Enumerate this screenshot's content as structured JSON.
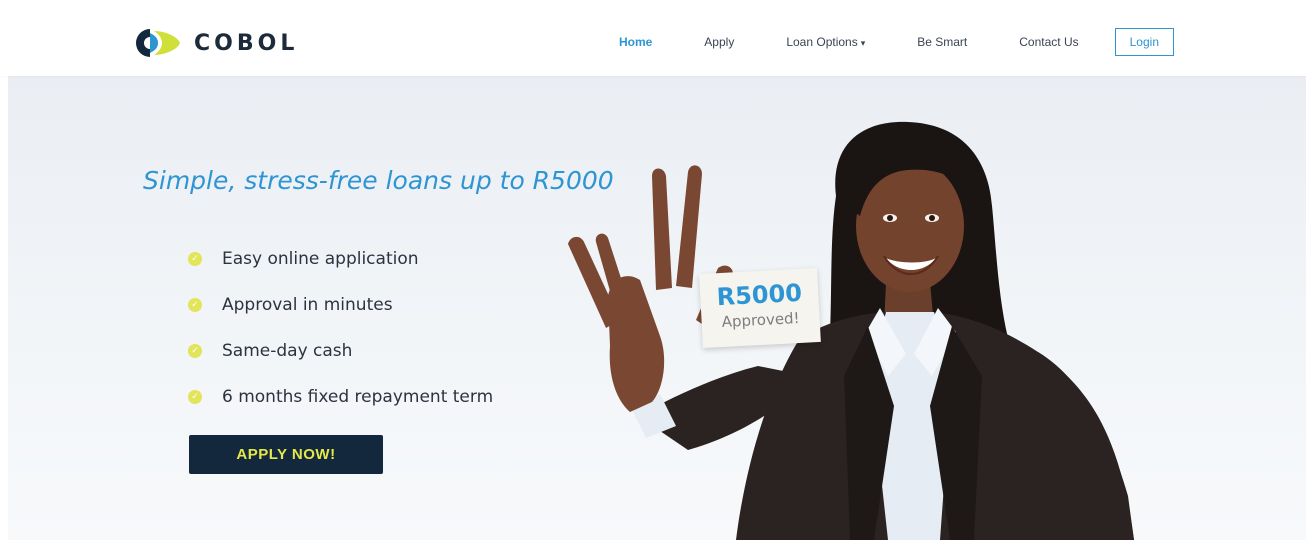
{
  "brand": {
    "name": "COBOL",
    "logo_icon": "cobol-logo-icon",
    "colors": {
      "dark": "#13283d",
      "accent": "#2e95d3",
      "highlight": "#e5e84a"
    }
  },
  "nav": {
    "items": [
      {
        "label": "Home",
        "active": true
      },
      {
        "label": "Apply",
        "active": false
      },
      {
        "label": "Loan Options",
        "active": false,
        "dropdown": true
      },
      {
        "label": "Be Smart",
        "active": false
      },
      {
        "label": "Contact Us",
        "active": false
      }
    ],
    "login_label": "Login"
  },
  "hero": {
    "headline": "Simple, stress-free loans up to R5000",
    "features": [
      "Easy online application",
      "Approval in minutes",
      "Same-day cash",
      "6 months fixed repayment term"
    ],
    "cta_label": "APPLY NOW!",
    "badge": {
      "amount": "R5000",
      "status": "Approved!"
    }
  }
}
